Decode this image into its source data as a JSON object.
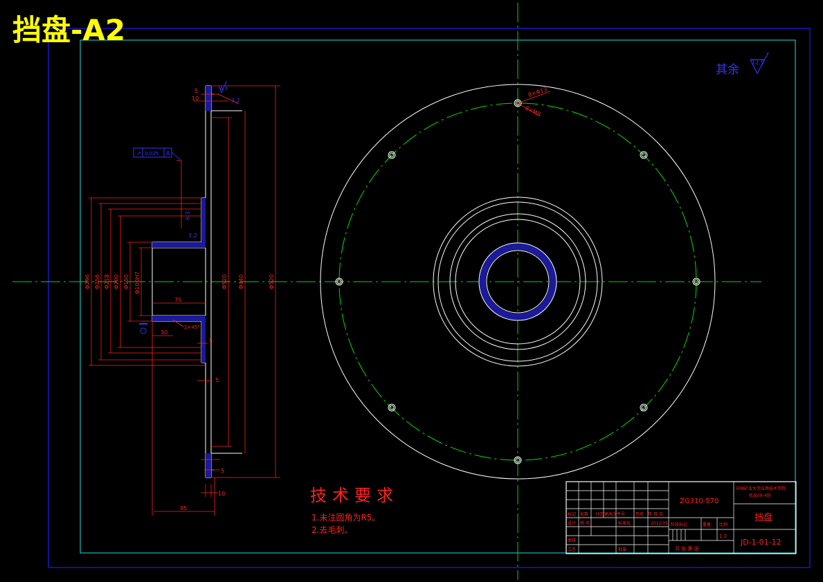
{
  "drawing": {
    "sheet_title": "挡盘-A2",
    "tech_req_title": "技术要求",
    "tech_req_lines": [
      "1.未注圆角为R5。",
      "2.去毛刺。"
    ],
    "roughness_other": "其余",
    "roughness_value": "12.5"
  },
  "title_block": {
    "material": "ZG310-570",
    "part_name": "挡盘",
    "drawing_number": "JD-1-01-12",
    "school": "中国矿业大学应用技术学院",
    "class_name": "机自08-4班",
    "scale": "1:2",
    "rev_headers": [
      "标记",
      "处数",
      "分区",
      "更改文件号",
      "签名",
      "年 月 日"
    ],
    "role_design": "设计",
    "role_check": "审核",
    "role_process": "工艺",
    "standardize": "标准化",
    "approve": "批准",
    "date": "2012.05",
    "stage_label": "阶段标记",
    "weight_label": "重量",
    "scale_label": "比例",
    "sheets_label": "共  张  第  张",
    "designer": "杨 伟"
  },
  "section_dims": {
    "top_5": "5",
    "top_10": "10",
    "ra_a": "3.2",
    "ra_b": "6.3",
    "ra_c": "3.2",
    "ra_d": "6.3",
    "tolerance_box": "0.025",
    "datum": "A",
    "d_outer": "Φ520",
    "d_green": "Φ440",
    "d_left1": "Φ296",
    "d_left2": "Φ256",
    "d_left3": "Φ218",
    "d_left4": "Φ200",
    "d_left5": "Φ150",
    "d_left6": "Φ100",
    "d_fit": "Φ100H7",
    "len_75": "75",
    "len_30": "30",
    "chamfer": "2×45°",
    "bot_5a": "5",
    "bot_5b": "5",
    "bot_5c": "5",
    "bot_10": "10",
    "len_95": "95"
  },
  "plan_dims": {
    "holes": "8×Φ13",
    "holes2": "8×M8"
  }
}
